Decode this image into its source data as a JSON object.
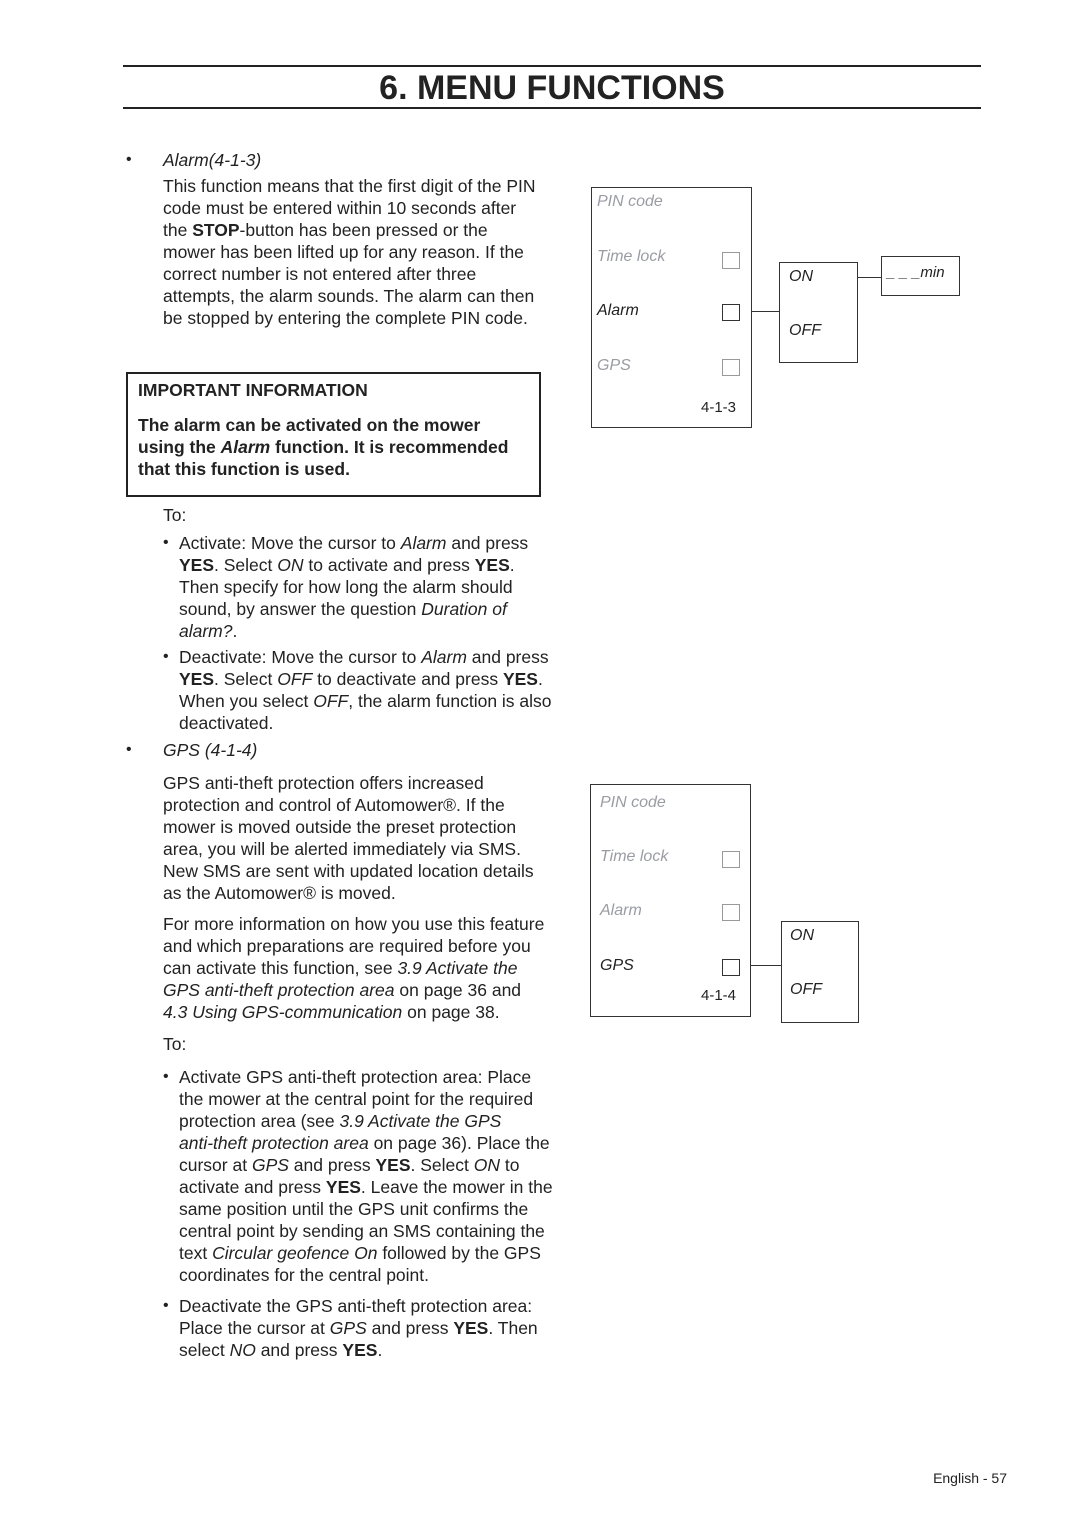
{
  "header": {
    "title": "6. MENU FUNCTIONS"
  },
  "alarm_section": {
    "bullet": "•",
    "heading": "Alarm(4-1-3)",
    "paragraph": [
      [
        {
          "t": "This function means that the first digit of the PIN"
        }
      ],
      [
        {
          "t": "code must be entered within 10 seconds after"
        }
      ],
      [
        {
          "t": "the "
        },
        {
          "t": "STOP",
          "s": "b"
        },
        {
          "t": "-button has been pressed or the"
        }
      ],
      [
        {
          "t": "mower has been lifted up for any reason. If the"
        }
      ],
      [
        {
          "t": "correct number is not entered after three"
        }
      ],
      [
        {
          "t": "attempts, the alarm sounds. The alarm can then"
        }
      ],
      [
        {
          "t": "be stopped by entering the complete PIN code."
        }
      ]
    ],
    "important": {
      "title": "IMPORTANT INFORMATION",
      "lines": [
        [
          {
            "t": "The alarm can be activated on the mower",
            "s": "b"
          }
        ],
        [
          {
            "t": "using the ",
            "s": "b"
          },
          {
            "t": "Alarm",
            "s": "bi"
          },
          {
            "t": " function. It is recommended",
            "s": "b"
          }
        ],
        [
          {
            "t": "that this function is used.",
            "s": "b"
          }
        ]
      ]
    },
    "to_label": "To:",
    "steps": [
      [
        [
          {
            "t": "Activate: Move the cursor to "
          },
          {
            "t": "Alarm",
            "s": "i"
          },
          {
            "t": " and press"
          }
        ],
        [
          {
            "t": "YES",
            "s": "b"
          },
          {
            "t": ". Select "
          },
          {
            "t": "ON",
            "s": "i"
          },
          {
            "t": " to activate and press "
          },
          {
            "t": "YES",
            "s": "b"
          },
          {
            "t": "."
          }
        ],
        [
          {
            "t": "Then specify for how long the alarm should"
          }
        ],
        [
          {
            "t": "sound, by answer the question "
          },
          {
            "t": "Duration of",
            "s": "i"
          }
        ],
        [
          {
            "t": "alarm?",
            "s": "i"
          },
          {
            "t": "."
          }
        ]
      ],
      [
        [
          {
            "t": "Deactivate: Move the cursor to "
          },
          {
            "t": "Alarm",
            "s": "i"
          },
          {
            "t": " and press"
          }
        ],
        [
          {
            "t": "YES",
            "s": "b"
          },
          {
            "t": ". Select "
          },
          {
            "t": "OFF",
            "s": "i"
          },
          {
            "t": " to deactivate and press "
          },
          {
            "t": "YES",
            "s": "b"
          },
          {
            "t": "."
          }
        ],
        [
          {
            "t": "When you select "
          },
          {
            "t": "OFF",
            "s": "i"
          },
          {
            "t": ", the alarm function is also"
          }
        ],
        [
          {
            "t": "deactivated."
          }
        ]
      ]
    ]
  },
  "gps_section": {
    "bullet": "•",
    "heading": "GPS (4-1-4)",
    "paragraph1": [
      [
        {
          "t": "GPS anti-theft protection offers increased"
        }
      ],
      [
        {
          "t": "protection and control of Automower®. If the"
        }
      ],
      [
        {
          "t": "mower is moved outside the preset protection"
        }
      ],
      [
        {
          "t": "area, you will be alerted immediately via SMS."
        }
      ],
      [
        {
          "t": "New SMS are sent with updated location details"
        }
      ],
      [
        {
          "t": "as the Automower® is moved."
        }
      ]
    ],
    "paragraph2": [
      [
        {
          "t": "For more information on how you use this feature"
        }
      ],
      [
        {
          "t": "and which preparations are required before you"
        }
      ],
      [
        {
          "t": "can activate this function, see "
        },
        {
          "t": "3.9 Activate the",
          "s": "i"
        }
      ],
      [
        {
          "t": "GPS anti-theft protection area",
          "s": "i"
        },
        {
          "t": " on page 36 and"
        }
      ],
      [
        {
          "t": "4.3 Using GPS-communication",
          "s": "i"
        },
        {
          "t": " on page 38."
        }
      ]
    ],
    "to_label": "To:",
    "steps": [
      [
        [
          {
            "t": "Activate GPS anti-theft protection area: Place"
          }
        ],
        [
          {
            "t": "the mower at the central point for the required"
          }
        ],
        [
          {
            "t": "protection area (see "
          },
          {
            "t": "3.9 Activate the GPS",
            "s": "i"
          }
        ],
        [
          {
            "t": "anti-theft protection area",
            "s": "i"
          },
          {
            "t": " on page 36). Place the"
          }
        ],
        [
          {
            "t": "cursor at "
          },
          {
            "t": "GPS",
            "s": "i"
          },
          {
            "t": " and press "
          },
          {
            "t": "YES",
            "s": "b"
          },
          {
            "t": ". Select "
          },
          {
            "t": "ON",
            "s": "i"
          },
          {
            "t": " to"
          }
        ],
        [
          {
            "t": "activate and press "
          },
          {
            "t": "YES",
            "s": "b"
          },
          {
            "t": ". Leave the mower in the"
          }
        ],
        [
          {
            "t": "same position until the GPS unit confirms the"
          }
        ],
        [
          {
            "t": "central point by sending an SMS containing the"
          }
        ],
        [
          {
            "t": "text "
          },
          {
            "t": "Circular geofence On",
            "s": "i"
          },
          {
            "t": " followed by the GPS"
          }
        ],
        [
          {
            "t": "coordinates for the central point."
          }
        ]
      ],
      [
        [
          {
            "t": "Deactivate the GPS anti-theft protection area:"
          }
        ],
        [
          {
            "t": "Place the cursor at "
          },
          {
            "t": "GPS",
            "s": "i"
          },
          {
            "t": " and press "
          },
          {
            "t": "YES",
            "s": "b"
          },
          {
            "t": ". Then"
          }
        ],
        [
          {
            "t": "select "
          },
          {
            "t": "NO",
            "s": "i"
          },
          {
            "t": " and press "
          },
          {
            "t": "YES",
            "s": "b"
          },
          {
            "t": "."
          }
        ]
      ]
    ],
    "step_bullet": "•"
  },
  "diagram_alarm": {
    "menu": [
      "PIN code",
      "Time lock",
      "Alarm",
      "GPS"
    ],
    "code": "4-1-3",
    "options": [
      "ON",
      "OFF"
    ],
    "duration": "_ _ _min"
  },
  "diagram_gps": {
    "menu": [
      "PIN code",
      "Time lock",
      "Alarm",
      "GPS"
    ],
    "code": "4-1-4",
    "options": [
      "ON",
      "OFF"
    ]
  },
  "footer": {
    "page_label": "English - 57"
  }
}
